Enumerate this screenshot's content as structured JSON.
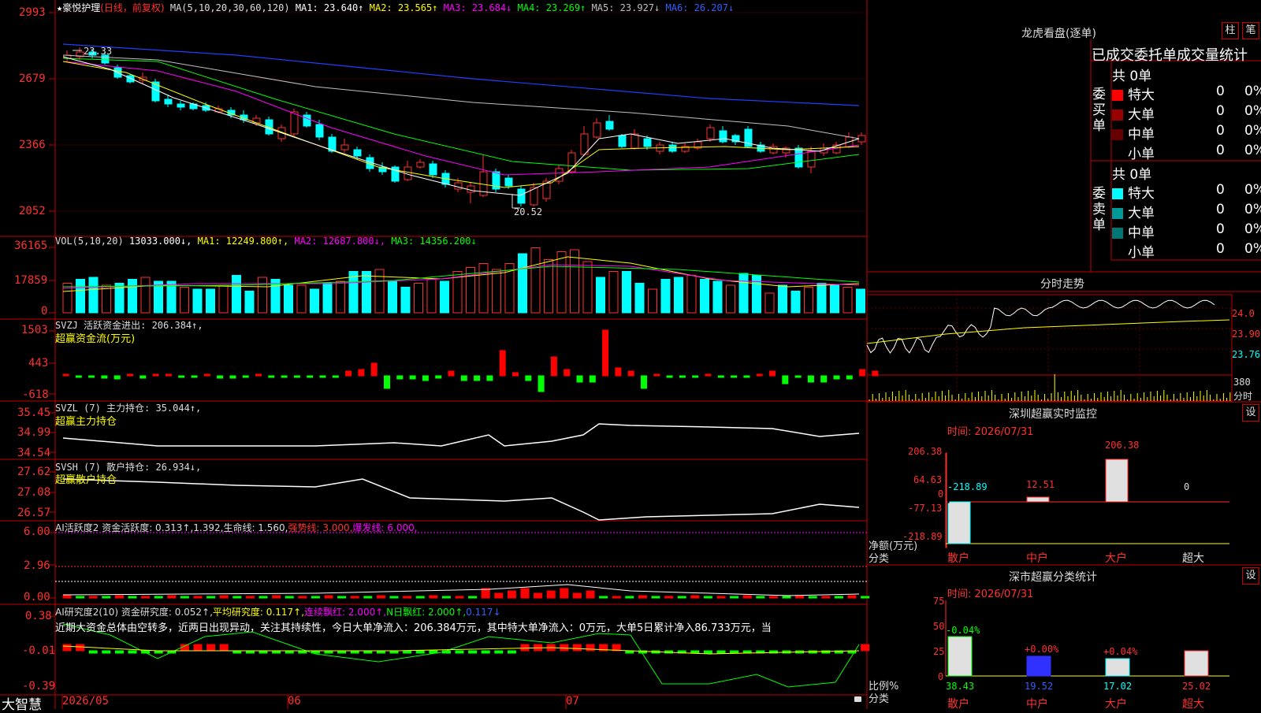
{
  "header": {
    "star": "★",
    "stock_name": "豪悦护理",
    "period": "(日线，前复权)",
    "ma_prefix": "MA(5,10,20,30,60,120)",
    "ma_items": [
      {
        "label": "MA1: 23.640↑",
        "color": "#ffffff"
      },
      {
        "label": "MA2: 23.565↑",
        "color": "#ffff00"
      },
      {
        "label": "MA3: 23.684↓",
        "color": "#ff00ff"
      },
      {
        "label": "MA4: 23.269↑",
        "color": "#00ff00"
      },
      {
        "label": "MA5: 23.927↓",
        "color": "#c0c0c0"
      },
      {
        "label": "MA6: 26.207↓",
        "color": "#3060ff"
      }
    ]
  },
  "price_axis": [
    "2993",
    "2679",
    "2366",
    "2052"
  ],
  "price_high": "23.33",
  "price_low": "20.52",
  "vol": {
    "title": "VOL(5,10,20)",
    "value": "13033.000↓,",
    "items": [
      {
        "label": "MA1: 12249.800↑,",
        "color": "#ffff00"
      },
      {
        "label": "MA2: 12687.800↓,",
        "color": "#ff00ff"
      },
      {
        "label": "MA3: 14356.200↓",
        "color": "#00ff00"
      }
    ],
    "axis": [
      "36165",
      "17859",
      "0"
    ]
  },
  "svzj": {
    "title": "SVZJ  活跃资金进出: 206.384↑,",
    "subtitle": "超赢资金流(万元)",
    "axis": [
      "1503",
      "443",
      "-618"
    ]
  },
  "svzl": {
    "title": "SVZL (7) 主力持仓: 35.044↑,",
    "subtitle": "超赢主力持仓",
    "axis": [
      "35.45",
      "34.99",
      "34.54"
    ]
  },
  "svsh": {
    "title": "SVSH (7) 散户持仓: 26.934↓,",
    "subtitle": "超赢散户持仓",
    "axis": [
      "27.62",
      "27.08",
      "26.57"
    ]
  },
  "ai1": {
    "prefix": "AI活跃度2 资金活跃度: 0.313↑,1.392,生命线: 1.560,",
    "strong": "强势线: 3.000,",
    "burst": "爆发线: 6.000,",
    "axis": [
      "6.00",
      "2.96",
      "0.00"
    ]
  },
  "ai2": {
    "prefix": "AI研究度2(10) 资金研究度: 0.052↑,",
    "avg": "平均研究度: 0.117↑,",
    "cont": "连续飘红: 2.000↑,",
    "nday": "N日飘红: 2.000↑,",
    "last": "0.117↓",
    "comment": "近期大资金总体由空转多，近两日出现异动，关注其持续性，今日大单净流入：206.384万元，其中特大单净流入：0万元，大单5日累计净入86.733万元，当",
    "axis": [
      "0.38",
      "-0.01",
      "-0.39"
    ]
  },
  "bottom": {
    "brand": "大智慧",
    "dates": [
      "2026/05",
      "06",
      "07"
    ]
  },
  "lhb": {
    "title": "龙虎看盘(逐单)",
    "btn1": "柱",
    "btn2": "笔",
    "tabs": "已成交委托单成交量统计",
    "buy_label": "委买单",
    "sell_label": "委卖单",
    "buy_total": "共 0单",
    "sell_total": "共 0单",
    "buy_rows": [
      {
        "name": "特大",
        "v": "0",
        "p": "0%",
        "color": "#ff0000"
      },
      {
        "name": "大单",
        "v": "0",
        "p": "0%",
        "color": "#990000"
      },
      {
        "name": "中单",
        "v": "0",
        "p": "0%",
        "color": "#660000"
      },
      {
        "name": "小单",
        "v": "0",
        "p": "0%",
        "color": "#000000"
      }
    ],
    "sell_rows": [
      {
        "name": "特大",
        "v": "0",
        "p": "0%",
        "color": "#00ffff"
      },
      {
        "name": "大单",
        "v": "0",
        "p": "0%",
        "color": "#009999"
      },
      {
        "name": "中单",
        "v": "0",
        "p": "0%",
        "color": "#007777"
      },
      {
        "name": "小单",
        "v": "0",
        "p": "0%",
        "color": "#000000"
      }
    ]
  },
  "intraday": {
    "title": "分时走势",
    "axis": [
      "24.0",
      "23.90",
      "23.76"
    ],
    "vol_axis": "380",
    "vol_label": "分时"
  },
  "sz_monitor": {
    "title": "深圳超赢实时监控",
    "btn": "设",
    "time": "时间: 2026/07/31",
    "axis": [
      "206.38",
      "64.63",
      "0",
      "-77.13",
      "-218.89"
    ],
    "ylabel": "净额(万元)",
    "xlabel": "分类",
    "cats": [
      "散户",
      "中户",
      "大户",
      "超大"
    ],
    "values": [
      "-218.89",
      "12.51",
      "206.38",
      "0"
    ]
  },
  "sz_stats": {
    "title": "深市超赢分类统计",
    "btn": "设",
    "time": "时间: 2026/07/31",
    "axis": [
      "75",
      "50",
      "25",
      "0"
    ],
    "ylabel": "比例%",
    "xlabel": "分类",
    "cats": [
      "散户",
      "中户",
      "大户",
      "超大"
    ],
    "values": [
      "38.43",
      "19.52",
      "17.02",
      "25.02"
    ],
    "changes": [
      "-0.04%",
      "+0.00%",
      "+0.04%",
      ""
    ]
  }
}
